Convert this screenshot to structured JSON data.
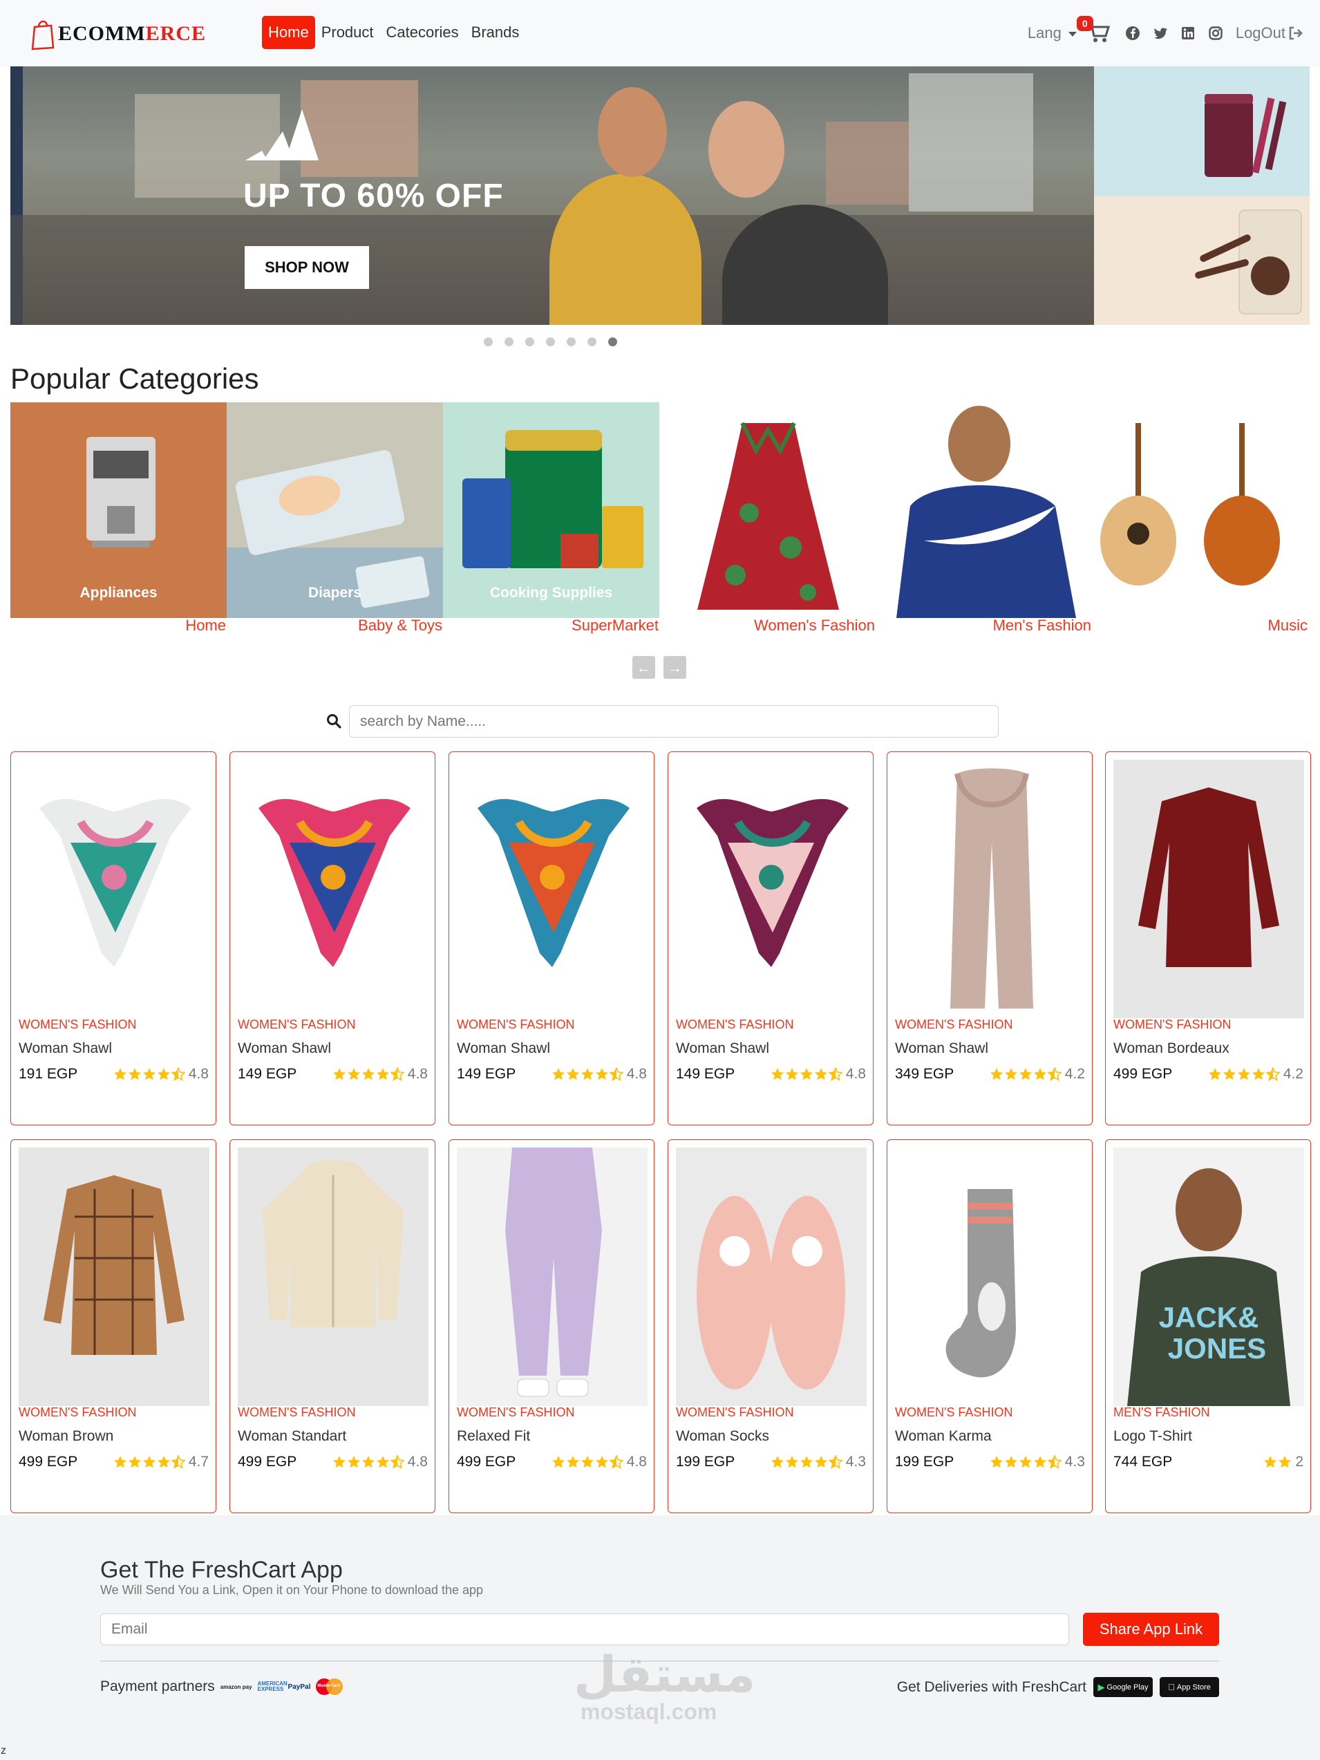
{
  "brand": {
    "logo_part1": "E",
    "logo_part2": "COMM",
    "logo_part3": "ERCE"
  },
  "nav": {
    "links": [
      {
        "label": "Home",
        "active": true
      },
      {
        "label": "Product",
        "active": false
      },
      {
        "label": "Catecories",
        "active": false
      },
      {
        "label": "Brands",
        "active": false
      }
    ],
    "lang": "Lang",
    "cart_count": "0",
    "logout": "LogOut"
  },
  "hero": {
    "headline": "UP TO 60% OFF",
    "button": "SHOP NOW",
    "slides": 7,
    "active_slide": 6
  },
  "categories": {
    "title": "Popular Categories",
    "items": [
      {
        "caption": "Appliances",
        "label": "Home"
      },
      {
        "caption": "Diapers",
        "label": "Baby & Toys"
      },
      {
        "caption": "Cooking Supplies",
        "label": "SuperMarket"
      },
      {
        "caption": "",
        "label": "Women's Fashion"
      },
      {
        "caption": "",
        "label": "Men's Fashion"
      },
      {
        "caption": "",
        "label": "Music"
      }
    ]
  },
  "search": {
    "placeholder": "search by Name....."
  },
  "products": [
    {
      "category": "Women's Fashion",
      "name": "Woman Shawl",
      "price": "191 EGP",
      "rating": "4.8",
      "stars": 4.5
    },
    {
      "category": "Women's Fashion",
      "name": "Woman Shawl",
      "price": "149 EGP",
      "rating": "4.8",
      "stars": 4.5
    },
    {
      "category": "Women's Fashion",
      "name": "Woman Shawl",
      "price": "149 EGP",
      "rating": "4.8",
      "stars": 4.5
    },
    {
      "category": "Women's Fashion",
      "name": "Woman Shawl",
      "price": "149 EGP",
      "rating": "4.8",
      "stars": 4.5
    },
    {
      "category": "Women's Fashion",
      "name": "Woman Shawl",
      "price": "349 EGP",
      "rating": "4.2",
      "stars": 4.5
    },
    {
      "category": "Women's Fashion",
      "name": "Woman Bordeaux",
      "price": "499 EGP",
      "rating": "4.2",
      "stars": 4.5
    },
    {
      "category": "Women's Fashion",
      "name": "Woman Brown",
      "price": "499 EGP",
      "rating": "4.7",
      "stars": 4.5
    },
    {
      "category": "Women's Fashion",
      "name": "Woman Standart",
      "price": "499 EGP",
      "rating": "4.8",
      "stars": 4.5
    },
    {
      "category": "Women's Fashion",
      "name": "Relaxed Fit",
      "price": "499 EGP",
      "rating": "4.8",
      "stars": 4.5
    },
    {
      "category": "Women's Fashion",
      "name": "Woman Socks",
      "price": "199 EGP",
      "rating": "4.3",
      "stars": 4.5
    },
    {
      "category": "Women's Fashion",
      "name": "Woman Karma",
      "price": "199 EGP",
      "rating": "4.3",
      "stars": 4.5
    },
    {
      "category": "Men's Fashion",
      "name": "Logo T-Shirt",
      "price": "744 EGP",
      "rating": "2",
      "stars": 2
    }
  ],
  "footer": {
    "title": "Get The FreshCart App",
    "subtitle": "We Will Send You a Link, Open it on Your Phone to download the app",
    "email_placeholder": "Email",
    "share_button": "Share App Link",
    "payment_label": "Payment partners",
    "payment_logos": [
      "amazon pay",
      "AMERICAN EXPRESS",
      "PayPal",
      "MasterCard"
    ],
    "deliveries_label": "Get Deliveries with FreshCart",
    "google_play": "Google Play",
    "app_store": "App Store"
  },
  "watermark": {
    "arabic": "مستقل",
    "latin": "mostaql.com"
  },
  "stray_text": "z",
  "colors": {
    "accent": "#f41f06",
    "category_red": "#f3371f",
    "star": "#ffc107"
  }
}
